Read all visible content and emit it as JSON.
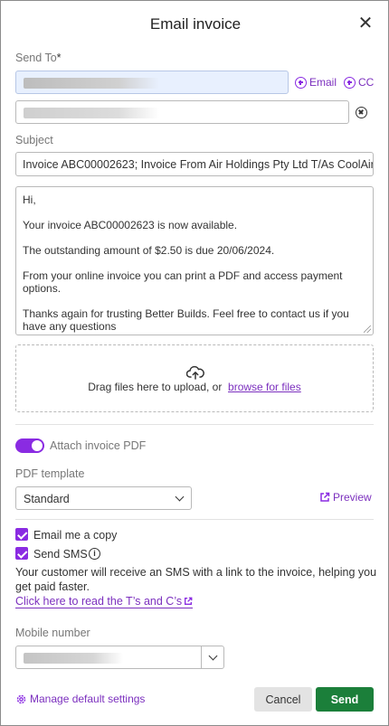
{
  "dialog": {
    "title": "Email invoice",
    "close_icon": "close-icon"
  },
  "send_to": {
    "label": "Send To",
    "required_mark": "*",
    "add_email_label": "Email",
    "add_cc_label": "CC"
  },
  "subject": {
    "label": "Subject",
    "value": "Invoice ABC00002623; Invoice From Air Holdings Pty Ltd T/As CoolAir"
  },
  "message": {
    "lines": [
      "Hi,",
      "Your invoice ABC00002623 is now available.",
      "The outstanding amount of $2.50 is due 20/06/2024.",
      "From your online invoice you can print a PDF and access payment options.",
      "Thanks again for trusting Better Builds. Feel free to contact us if you have any questions"
    ]
  },
  "upload": {
    "text": "Drag files here to upload, or",
    "link": "browse for files"
  },
  "attach_pdf": {
    "label": "Attach invoice PDF",
    "enabled": true
  },
  "pdf_template": {
    "label": "PDF template",
    "selected": "Standard",
    "preview_label": "Preview"
  },
  "options": {
    "email_copy_label": "Email me a copy",
    "email_copy_checked": true,
    "send_sms_label": "Send SMS",
    "send_sms_checked": true,
    "sms_note": "Your customer will receive an SMS with a link to the invoice, helping you get paid faster.",
    "tc_link": "Click here to read the T’s and C’s"
  },
  "mobile": {
    "label": "Mobile number"
  },
  "footer": {
    "manage_label": "Manage default settings",
    "cancel_label": "Cancel",
    "send_label": "Send"
  },
  "colors": {
    "accent": "#8a2be2",
    "link": "#7b2fbe",
    "send_button": "#1b7f3a"
  }
}
